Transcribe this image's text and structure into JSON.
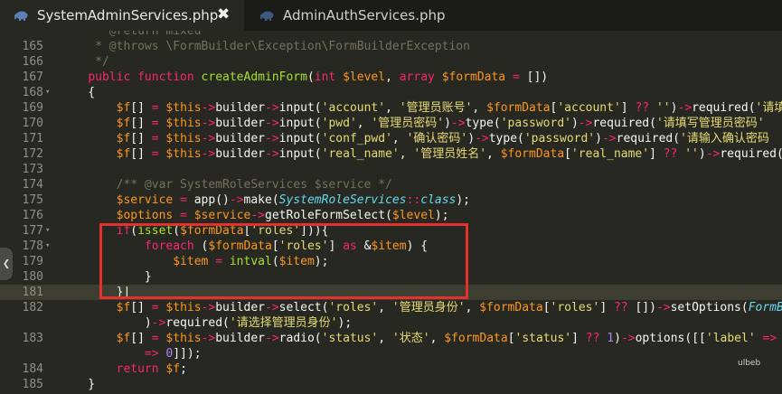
{
  "tabs": [
    {
      "label": "SystemAdminServices.php",
      "close": "✖",
      "icon": "php-elephant-icon"
    },
    {
      "label": "AdminAuthServices.php",
      "icon": "php-elephant-icon"
    }
  ],
  "collapse_arrow": "❮",
  "watermark": "ulbeb",
  "code_lines": [
    {
      "num": "",
      "tokens": [
        {
          "t": "     * @return mixed",
          "c": "c"
        }
      ]
    },
    {
      "num": "165",
      "tokens": [
        {
          "t": "     * @throws \\FormBuilder\\Exception\\FormBuilderException",
          "c": "c"
        }
      ]
    },
    {
      "num": "166",
      "tokens": [
        {
          "t": "     */",
          "c": "c"
        }
      ]
    },
    {
      "num": "167",
      "tokens": [
        {
          "t": "    ",
          "c": ""
        },
        {
          "t": "public function ",
          "c": "k"
        },
        {
          "t": "createAdminForm",
          "c": "f"
        },
        {
          "t": "(",
          "c": ""
        },
        {
          "t": "int ",
          "c": "k"
        },
        {
          "t": "$level",
          "c": "v"
        },
        {
          "t": ", ",
          "c": ""
        },
        {
          "t": "array ",
          "c": "k"
        },
        {
          "t": "$formData",
          "c": "v"
        },
        {
          "t": " = ",
          "c": "k"
        },
        {
          "t": "[])",
          "c": ""
        }
      ]
    },
    {
      "num": "168",
      "fold": "▾",
      "tokens": [
        {
          "t": "    {",
          "c": ""
        }
      ]
    },
    {
      "num": "169",
      "tokens": [
        {
          "t": "        ",
          "c": ""
        },
        {
          "t": "$f",
          "c": "v"
        },
        {
          "t": "[] ",
          "c": ""
        },
        {
          "t": "=",
          "c": "k"
        },
        {
          "t": " ",
          "c": ""
        },
        {
          "t": "$this",
          "c": "v"
        },
        {
          "t": "->",
          "c": "k"
        },
        {
          "t": "builder",
          "c": ""
        },
        {
          "t": "->",
          "c": "k"
        },
        {
          "t": "input(",
          "c": ""
        },
        {
          "t": "'account'",
          "c": "s"
        },
        {
          "t": ", ",
          "c": ""
        },
        {
          "t": "'管理员账号'",
          "c": "s"
        },
        {
          "t": ", ",
          "c": ""
        },
        {
          "t": "$formData",
          "c": "v"
        },
        {
          "t": "[",
          "c": ""
        },
        {
          "t": "'account'",
          "c": "s"
        },
        {
          "t": "] ",
          "c": ""
        },
        {
          "t": "??",
          "c": "k"
        },
        {
          "t": " ",
          "c": ""
        },
        {
          "t": "''",
          "c": "s"
        },
        {
          "t": ")",
          "c": ""
        },
        {
          "t": "->",
          "c": "k"
        },
        {
          "t": "required(",
          "c": ""
        },
        {
          "t": "'请填",
          "c": "s"
        }
      ]
    },
    {
      "num": "170",
      "tokens": [
        {
          "t": "        ",
          "c": ""
        },
        {
          "t": "$f",
          "c": "v"
        },
        {
          "t": "[] ",
          "c": ""
        },
        {
          "t": "=",
          "c": "k"
        },
        {
          "t": " ",
          "c": ""
        },
        {
          "t": "$this",
          "c": "v"
        },
        {
          "t": "->",
          "c": "k"
        },
        {
          "t": "builder",
          "c": ""
        },
        {
          "t": "->",
          "c": "k"
        },
        {
          "t": "input(",
          "c": ""
        },
        {
          "t": "'pwd'",
          "c": "s"
        },
        {
          "t": ", ",
          "c": ""
        },
        {
          "t": "'管理员密码'",
          "c": "s"
        },
        {
          "t": ")",
          "c": ""
        },
        {
          "t": "->",
          "c": "k"
        },
        {
          "t": "type(",
          "c": ""
        },
        {
          "t": "'password'",
          "c": "s"
        },
        {
          "t": ")",
          "c": ""
        },
        {
          "t": "->",
          "c": "k"
        },
        {
          "t": "required(",
          "c": ""
        },
        {
          "t": "'请填写管理员密码'",
          "c": "s"
        }
      ]
    },
    {
      "num": "171",
      "tokens": [
        {
          "t": "        ",
          "c": ""
        },
        {
          "t": "$f",
          "c": "v"
        },
        {
          "t": "[] ",
          "c": ""
        },
        {
          "t": "=",
          "c": "k"
        },
        {
          "t": " ",
          "c": ""
        },
        {
          "t": "$this",
          "c": "v"
        },
        {
          "t": "->",
          "c": "k"
        },
        {
          "t": "builder",
          "c": ""
        },
        {
          "t": "->",
          "c": "k"
        },
        {
          "t": "input(",
          "c": ""
        },
        {
          "t": "'conf_pwd'",
          "c": "s"
        },
        {
          "t": ", ",
          "c": ""
        },
        {
          "t": "'确认密码'",
          "c": "s"
        },
        {
          "t": ")",
          "c": ""
        },
        {
          "t": "->",
          "c": "k"
        },
        {
          "t": "type(",
          "c": ""
        },
        {
          "t": "'password'",
          "c": "s"
        },
        {
          "t": ")",
          "c": ""
        },
        {
          "t": "->",
          "c": "k"
        },
        {
          "t": "required(",
          "c": ""
        },
        {
          "t": "'请输入确认密码",
          "c": "s"
        }
      ]
    },
    {
      "num": "172",
      "tokens": [
        {
          "t": "        ",
          "c": ""
        },
        {
          "t": "$f",
          "c": "v"
        },
        {
          "t": "[] ",
          "c": ""
        },
        {
          "t": "=",
          "c": "k"
        },
        {
          "t": " ",
          "c": ""
        },
        {
          "t": "$this",
          "c": "v"
        },
        {
          "t": "->",
          "c": "k"
        },
        {
          "t": "builder",
          "c": ""
        },
        {
          "t": "->",
          "c": "k"
        },
        {
          "t": "input(",
          "c": ""
        },
        {
          "t": "'real_name'",
          "c": "s"
        },
        {
          "t": ", ",
          "c": ""
        },
        {
          "t": "'管理员姓名'",
          "c": "s"
        },
        {
          "t": ", ",
          "c": ""
        },
        {
          "t": "$formData",
          "c": "v"
        },
        {
          "t": "[",
          "c": ""
        },
        {
          "t": "'real_name'",
          "c": "s"
        },
        {
          "t": "] ",
          "c": ""
        },
        {
          "t": "??",
          "c": "k"
        },
        {
          "t": " ",
          "c": ""
        },
        {
          "t": "''",
          "c": "s"
        },
        {
          "t": ")",
          "c": ""
        },
        {
          "t": "->",
          "c": "k"
        },
        {
          "t": "required(",
          "c": ""
        }
      ]
    },
    {
      "num": "173",
      "tokens": []
    },
    {
      "num": "174",
      "tokens": [
        {
          "t": "        /** @var SystemRoleServices $service */",
          "c": "c"
        }
      ]
    },
    {
      "num": "175",
      "tokens": [
        {
          "t": "        ",
          "c": ""
        },
        {
          "t": "$service",
          "c": "v"
        },
        {
          "t": " ",
          "c": ""
        },
        {
          "t": "=",
          "c": "k"
        },
        {
          "t": " app()",
          "c": ""
        },
        {
          "t": "->",
          "c": "k"
        },
        {
          "t": "make(",
          "c": ""
        },
        {
          "t": "SystemRoleServices",
          "c": "t"
        },
        {
          "t": "::",
          "c": "k"
        },
        {
          "t": "class",
          "c": "d"
        },
        {
          "t": ");",
          "c": ""
        }
      ]
    },
    {
      "num": "176",
      "tokens": [
        {
          "t": "        ",
          "c": ""
        },
        {
          "t": "$options",
          "c": "v"
        },
        {
          "t": " ",
          "c": ""
        },
        {
          "t": "=",
          "c": "k"
        },
        {
          "t": " ",
          "c": ""
        },
        {
          "t": "$service",
          "c": "v"
        },
        {
          "t": "->",
          "c": "k"
        },
        {
          "t": "getRoleFormSelect(",
          "c": ""
        },
        {
          "t": "$level",
          "c": "v"
        },
        {
          "t": ");",
          "c": ""
        }
      ]
    },
    {
      "num": "177",
      "fold": "▾",
      "tokens": [
        {
          "t": "        ",
          "c": ""
        },
        {
          "t": "if",
          "c": "k"
        },
        {
          "t": "(",
          "c": ""
        },
        {
          "t": "isset",
          "c": "f"
        },
        {
          "t": "(",
          "c": ""
        },
        {
          "t": "$formData",
          "c": "v"
        },
        {
          "t": "[",
          "c": ""
        },
        {
          "t": "'roles'",
          "c": "s"
        },
        {
          "t": "])){",
          "c": ""
        }
      ]
    },
    {
      "num": "178",
      "fold": "▾",
      "tokens": [
        {
          "t": "            ",
          "c": ""
        },
        {
          "t": "foreach",
          "c": "k"
        },
        {
          "t": " (",
          "c": ""
        },
        {
          "t": "$formData",
          "c": "v"
        },
        {
          "t": "[",
          "c": ""
        },
        {
          "t": "'roles'",
          "c": "s"
        },
        {
          "t": "] ",
          "c": ""
        },
        {
          "t": "as",
          "c": "k"
        },
        {
          "t": " &",
          "c": ""
        },
        {
          "t": "$item",
          "c": "v"
        },
        {
          "t": ") {",
          "c": ""
        }
      ]
    },
    {
      "num": "179",
      "tokens": [
        {
          "t": "                ",
          "c": ""
        },
        {
          "t": "$item",
          "c": "v"
        },
        {
          "t": " ",
          "c": ""
        },
        {
          "t": "=",
          "c": "k"
        },
        {
          "t": " ",
          "c": ""
        },
        {
          "t": "intval",
          "c": "f"
        },
        {
          "t": "(",
          "c": ""
        },
        {
          "t": "$item",
          "c": "v"
        },
        {
          "t": ");",
          "c": ""
        }
      ]
    },
    {
      "num": "180",
      "tokens": [
        {
          "t": "            }",
          "c": ""
        }
      ]
    },
    {
      "num": "181",
      "current": true,
      "tokens": [
        {
          "t": "        }",
          "c": ""
        },
        {
          "t": "|",
          "c": ""
        }
      ]
    },
    {
      "num": "182",
      "tokens": [
        {
          "t": "        ",
          "c": ""
        },
        {
          "t": "$f",
          "c": "v"
        },
        {
          "t": "[] ",
          "c": ""
        },
        {
          "t": "=",
          "c": "k"
        },
        {
          "t": " ",
          "c": ""
        },
        {
          "t": "$this",
          "c": "v"
        },
        {
          "t": "->",
          "c": "k"
        },
        {
          "t": "builder",
          "c": ""
        },
        {
          "t": "->",
          "c": "k"
        },
        {
          "t": "select(",
          "c": ""
        },
        {
          "t": "'roles'",
          "c": "s"
        },
        {
          "t": ", ",
          "c": ""
        },
        {
          "t": "'管理员身份'",
          "c": "s"
        },
        {
          "t": ", ",
          "c": ""
        },
        {
          "t": "$formData",
          "c": "v"
        },
        {
          "t": "[",
          "c": ""
        },
        {
          "t": "'roles'",
          "c": "s"
        },
        {
          "t": "] ",
          "c": ""
        },
        {
          "t": "??",
          "c": "k"
        },
        {
          "t": " [])",
          "c": ""
        },
        {
          "t": "->",
          "c": "k"
        },
        {
          "t": "setOptions(",
          "c": ""
        },
        {
          "t": "FormBu",
          "c": "t"
        }
      ]
    },
    {
      "num": "",
      "tokens": [
        {
          "t": "            )",
          "c": ""
        },
        {
          "t": "->",
          "c": "k"
        },
        {
          "t": "required(",
          "c": ""
        },
        {
          "t": "'请选择管理员身份'",
          "c": "s"
        },
        {
          "t": ");",
          "c": ""
        }
      ]
    },
    {
      "num": "183",
      "tokens": [
        {
          "t": "        ",
          "c": ""
        },
        {
          "t": "$f",
          "c": "v"
        },
        {
          "t": "[] ",
          "c": ""
        },
        {
          "t": "=",
          "c": "k"
        },
        {
          "t": " ",
          "c": ""
        },
        {
          "t": "$this",
          "c": "v"
        },
        {
          "t": "->",
          "c": "k"
        },
        {
          "t": "builder",
          "c": ""
        },
        {
          "t": "->",
          "c": "k"
        },
        {
          "t": "radio(",
          "c": ""
        },
        {
          "t": "'status'",
          "c": "s"
        },
        {
          "t": ", ",
          "c": ""
        },
        {
          "t": "'状态'",
          "c": "s"
        },
        {
          "t": ", ",
          "c": ""
        },
        {
          "t": "$formData",
          "c": "v"
        },
        {
          "t": "[",
          "c": ""
        },
        {
          "t": "'status'",
          "c": "s"
        },
        {
          "t": "] ",
          "c": ""
        },
        {
          "t": "??",
          "c": "k"
        },
        {
          "t": " ",
          "c": ""
        },
        {
          "t": "1",
          "c": "n"
        },
        {
          "t": ")",
          "c": ""
        },
        {
          "t": "->",
          "c": "k"
        },
        {
          "t": "options([[",
          "c": ""
        },
        {
          "t": "'label'",
          "c": "s"
        },
        {
          "t": " ",
          "c": ""
        },
        {
          "t": "=>",
          "c": "k"
        },
        {
          "t": " '",
          "c": "s"
        }
      ]
    },
    {
      "num": "",
      "tokens": [
        {
          "t": "            ",
          "c": ""
        },
        {
          "t": "=>",
          "c": "k"
        },
        {
          "t": " ",
          "c": ""
        },
        {
          "t": "0",
          "c": "n"
        },
        {
          "t": "]]);",
          "c": ""
        }
      ]
    },
    {
      "num": "184",
      "tokens": [
        {
          "t": "        ",
          "c": ""
        },
        {
          "t": "return",
          "c": "k"
        },
        {
          "t": " ",
          "c": ""
        },
        {
          "t": "$f",
          "c": "v"
        },
        {
          "t": ";",
          "c": ""
        }
      ]
    },
    {
      "num": "185",
      "tokens": [
        {
          "t": "    }",
          "c": ""
        }
      ]
    }
  ]
}
